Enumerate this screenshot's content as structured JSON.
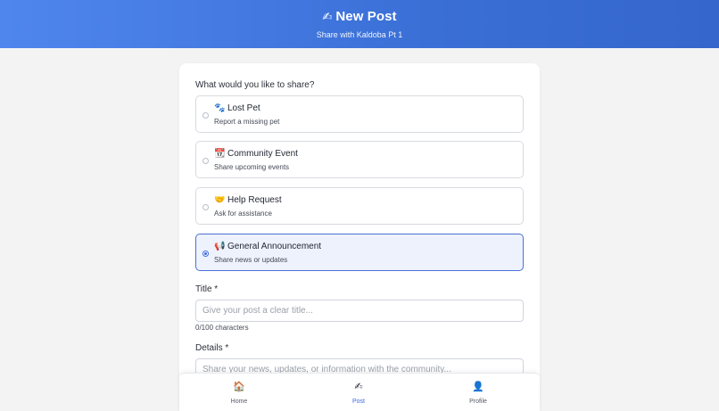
{
  "header": {
    "title_icon": "✍",
    "title": "New Post",
    "subtitle": "Share with Kaldoba Pt 1"
  },
  "form": {
    "question": "What would you like to share?",
    "options": [
      {
        "icon": "🐾",
        "label": "Lost Pet",
        "description": "Report a missing pet",
        "selected": false
      },
      {
        "icon": "📆",
        "label": "Community Event",
        "description": "Share upcoming events",
        "selected": false
      },
      {
        "icon": "🤝",
        "label": "Help Request",
        "description": "Ask for assistance",
        "selected": false
      },
      {
        "icon": "📢",
        "label": "General Announcement",
        "description": "Share news or updates",
        "selected": true
      }
    ],
    "title_label": "Title *",
    "title_placeholder": "Give your post a clear title...",
    "title_value": "",
    "title_counter": "0/100 characters",
    "details_label": "Details *",
    "details_placeholder": "Share your news, updates, or information with the community...",
    "details_value": ""
  },
  "nav": {
    "items": [
      {
        "icon": "🏠",
        "label": "Home",
        "active": false
      },
      {
        "icon": "✍",
        "label": "Post",
        "active": true
      },
      {
        "icon": "👤",
        "label": "Profile",
        "active": false
      }
    ]
  },
  "colors": {
    "header_start": "#4f86ee",
    "header_end": "#3566cc",
    "accent": "#3c6ae0",
    "selected_bg": "#eef2fd",
    "page_bg": "#f3f3f4"
  }
}
